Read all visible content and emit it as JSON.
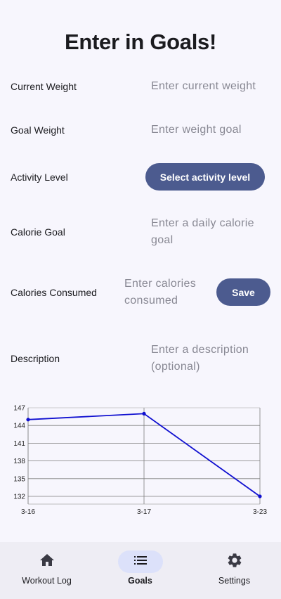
{
  "page": {
    "title": "Enter in Goals!"
  },
  "form": {
    "current_weight": {
      "label": "Current Weight",
      "placeholder": "Enter current weight",
      "value": ""
    },
    "goal_weight": {
      "label": "Goal Weight",
      "placeholder": "Enter weight goal",
      "value": ""
    },
    "activity_level": {
      "label": "Activity Level",
      "button_label": "Select activity level"
    },
    "calorie_goal": {
      "label": "Calorie Goal",
      "placeholder": "Enter a daily calorie goal",
      "value": ""
    },
    "calories_consumed": {
      "label": "Calories Consumed",
      "placeholder": "Enter calories consumed",
      "value": "",
      "save_label": "Save"
    },
    "description": {
      "label": "Description",
      "placeholder": "Enter a description (optional)",
      "value": ""
    }
  },
  "chart_data": {
    "type": "line",
    "x": [
      "3-16",
      "3-17",
      "3-23"
    ],
    "series": [
      {
        "values": [
          145,
          146,
          132
        ]
      }
    ],
    "ylim": [
      132,
      147
    ],
    "yticks": [
      147,
      144,
      141,
      138,
      135,
      132
    ],
    "grid": true,
    "color": "#1010d0"
  },
  "nav": {
    "items": [
      {
        "label": "Workout Log",
        "icon": "home-icon",
        "active": false
      },
      {
        "label": "Goals",
        "icon": "list-icon",
        "active": true
      },
      {
        "label": "Settings",
        "icon": "gear-icon",
        "active": false
      }
    ]
  },
  "colors": {
    "background": "#f7f6fd",
    "button": "#4c5b8f",
    "nav_background": "#eeedf4",
    "nav_active_pill": "#dce1fa",
    "line": "#1010d0"
  }
}
